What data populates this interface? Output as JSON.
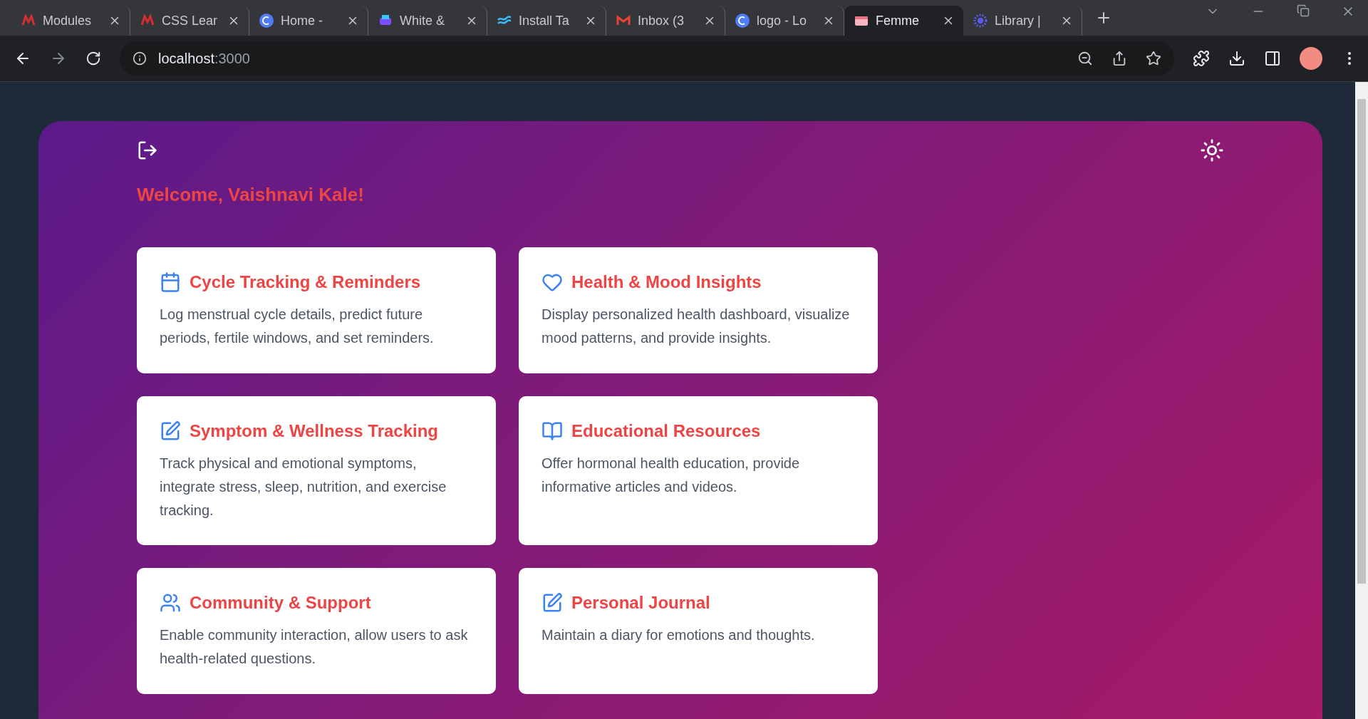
{
  "browser": {
    "tabs": [
      {
        "title": "Modules",
        "selected": false
      },
      {
        "title": "CSS Lear",
        "selected": false
      },
      {
        "title": "Home - ",
        "selected": false
      },
      {
        "title": "White &",
        "selected": false
      },
      {
        "title": "Install Ta",
        "selected": false
      },
      {
        "title": "Inbox (3",
        "selected": false
      },
      {
        "title": "logo - Lo",
        "selected": false
      },
      {
        "title": "Femme ",
        "selected": true
      },
      {
        "title": "Library |",
        "selected": false
      }
    ],
    "address": {
      "host": "localhost",
      "port": ":3000"
    }
  },
  "page": {
    "greeting": "Welcome, Vaishnavi Kale!",
    "features": [
      {
        "title": "Cycle Tracking & Reminders",
        "description": "Log menstrual cycle details, predict future periods, fertile windows, and set reminders."
      },
      {
        "title": "Health & Mood Insights",
        "description": "Display personalized health dashboard, visualize mood patterns, and provide insights."
      },
      {
        "title": "Symptom & Wellness Tracking",
        "description": "Track physical and emotional symptoms, integrate stress, sleep, nutrition, and exercise tracking."
      },
      {
        "title": "Educational Resources",
        "description": "Offer hormonal health education, provide informative articles and videos."
      },
      {
        "title": "Community & Support",
        "description": "Enable community interaction, allow users to ask health-related questions."
      },
      {
        "title": "Personal Journal",
        "description": "Maintain a diary for emotions and thoughts."
      }
    ]
  }
}
